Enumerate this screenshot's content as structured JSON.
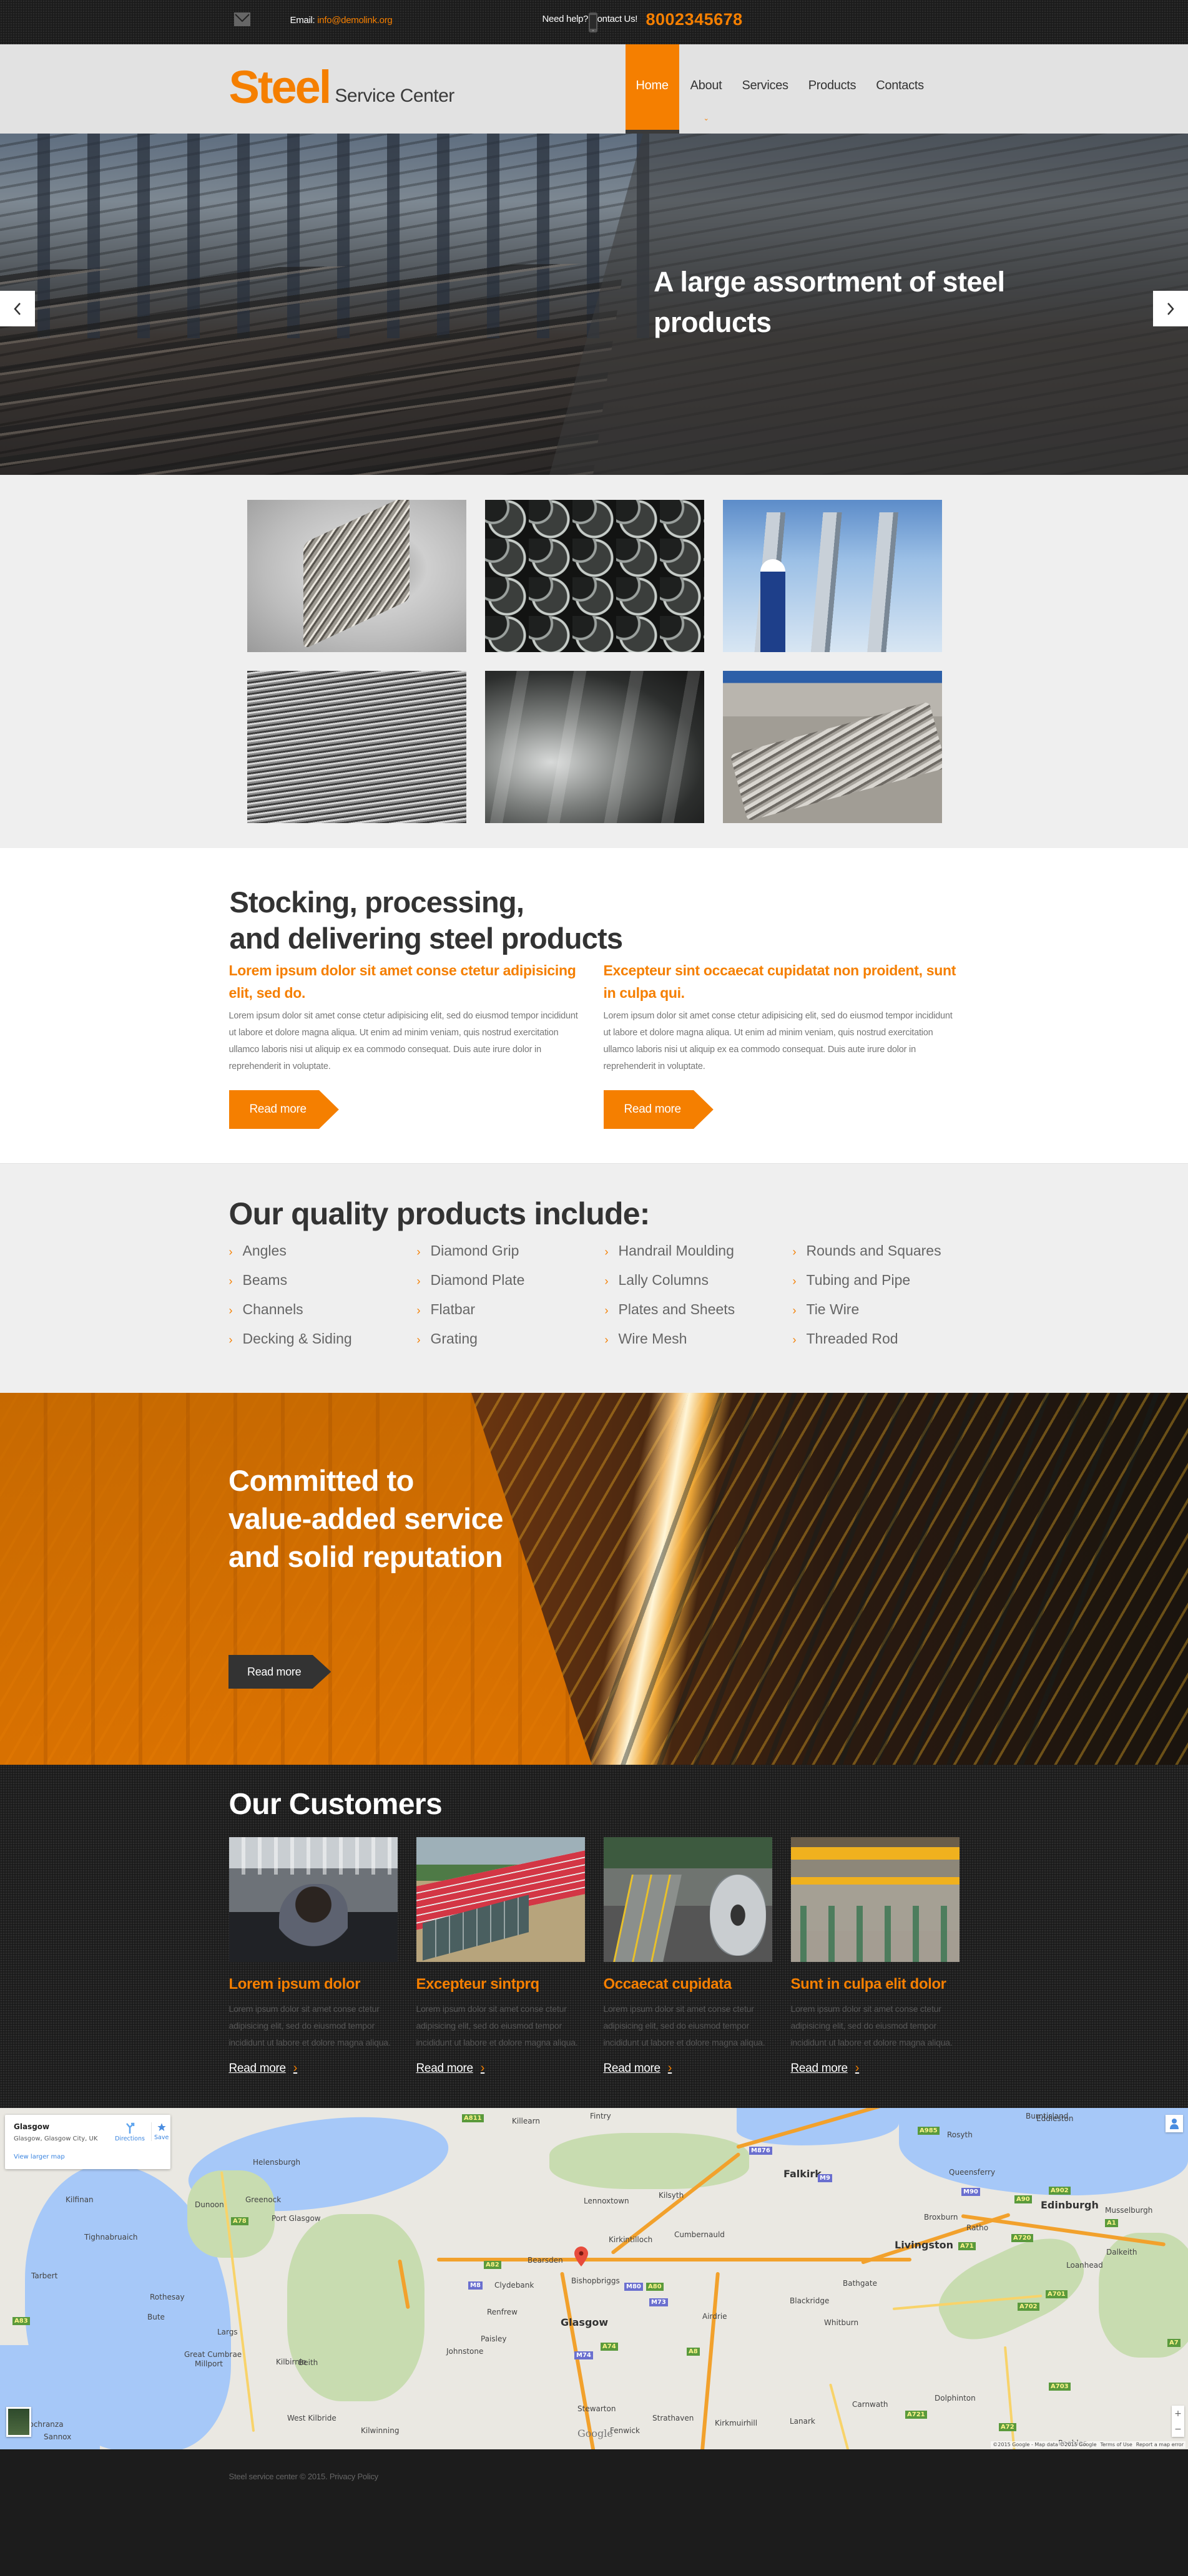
{
  "topbar": {
    "email_label": "Email:",
    "email_value": "info@demolink.org",
    "help_text": "Need help? Contact Us!",
    "phone": "8002345678"
  },
  "header": {
    "logo_main": "Steel",
    "logo_sub": "Service Center",
    "nav": [
      {
        "label": "Home",
        "active": true
      },
      {
        "label": "About",
        "has_dropdown": true
      },
      {
        "label": "Services"
      },
      {
        "label": "Products"
      },
      {
        "label": "Contacts"
      }
    ]
  },
  "hero": {
    "title": "A large assortment of steel products",
    "prev_icon": "chevron-left-icon",
    "next_icon": "chevron-right-icon"
  },
  "gallery": {
    "images": [
      {
        "alt": "Stacked steel tubes"
      },
      {
        "alt": "Steel pipe ends"
      },
      {
        "alt": "Industrial steel columns with worker"
      },
      {
        "alt": "Coiled steel wire"
      },
      {
        "alt": "Polished steel sheets"
      },
      {
        "alt": "Steel pipes on pallets"
      }
    ]
  },
  "intro": {
    "title_line1": "Stocking, processing,",
    "title_line2": "and delivering steel products",
    "columns": [
      {
        "subtitle": "Lorem ipsum dolor sit amet conse ctetur adipisicing elit, sed do.",
        "text": "Lorem ipsum dolor sit amet conse ctetur adipisicing elit, sed do eiusmod tempor incididunt ut labore et dolore magna aliqua. Ut enim ad minim veniam, quis nostrud exercitation ullamco laboris nisi ut aliquip ex ea commodo consequat. Duis aute irure dolor in reprehenderit in voluptate.",
        "button": "Read more"
      },
      {
        "subtitle": "Excepteur sint occaecat cupidatat non proident, sunt in culpa qui.",
        "text": "Lorem ipsum dolor sit amet conse ctetur adipisicing elit, sed do eiusmod tempor incididunt ut labore et dolore magna aliqua. Ut enim ad minim veniam, quis nostrud exercitation ullamco laboris nisi ut aliquip ex ea commodo consequat. Duis aute irure dolor in reprehenderit in voluptate.",
        "button": "Read more"
      }
    ]
  },
  "products": {
    "title": "Our quality products include:",
    "items": [
      "Angles",
      "Diamond Grip",
      "Handrail Moulding",
      "Rounds and Squares",
      "Beams",
      "Diamond Plate",
      "Lally Columns",
      "Tubing and Pipe",
      "Channels",
      "Flatbar",
      "Plates and Sheets",
      "Tie Wire",
      "Decking & Siding",
      "Grating",
      "Wire Mesh",
      "Threaded Rod"
    ]
  },
  "banner": {
    "title": "Committed to value-added service and solid reputation",
    "button": "Read more"
  },
  "customers": {
    "title": "Our Customers",
    "items": [
      {
        "name": "Lorem ipsum dolor",
        "text": "Lorem ipsum dolor sit amet conse ctetur adipisicing elit, sed do eiusmod tempor incididunt ut labore et dolore magna aliqua.",
        "link": "Read more"
      },
      {
        "name": "Excepteur sintprq",
        "text": "Lorem ipsum dolor sit amet conse ctetur adipisicing elit, sed do eiusmod tempor incididunt ut labore et dolore magna aliqua.",
        "link": "Read more"
      },
      {
        "name": "Occaecat cupidata",
        "text": "Lorem ipsum dolor sit amet conse ctetur adipisicing elit, sed do eiusmod tempor incididunt ut labore et dolore magna aliqua.",
        "link": "Read more"
      },
      {
        "name": "Sunt in culpa elit dolor",
        "text": "Lorem ipsum dolor sit amet conse ctetur adipisicing elit, sed do eiusmod tempor incididunt ut labore et dolore magna aliqua.",
        "link": "Read more"
      }
    ]
  },
  "map": {
    "card": {
      "title": "Glasgow",
      "address": "Glasgow, Glasgow City, UK",
      "view_larger": "View larger map",
      "directions": "Directions",
      "save": "Save"
    },
    "labels": [
      "Killearn",
      "Fintry",
      "Falkirk",
      "Kilsyth",
      "Lennoxtown",
      "Kirkintilloch",
      "Cumbernauld",
      "Bearsden",
      "Clydebank",
      "Bishopbriggs",
      "Renfrew",
      "Glasgow",
      "Paisley",
      "Johnstone",
      "Airdrie",
      "Blackridge",
      "Bathgate",
      "Whitburn",
      "Edinburgh",
      "Livingston",
      "Musselburgh",
      "Dalkeith",
      "Queensferry",
      "Rosyth",
      "Burntisland",
      "Broxburn",
      "Ratho",
      "Loanhead",
      "Helensburgh",
      "Greenock",
      "Port Glasgow",
      "Dunoon",
      "Rothesay",
      "Bute",
      "Largs",
      "Great Cumbrae",
      "Millport",
      "Kilbirnie",
      "Beith",
      "West Kilbride",
      "Kilwinning",
      "Stewarton",
      "Fenwick",
      "Strathaven",
      "Kirkmuirhill",
      "Lanark",
      "Carnwath",
      "Dolphinton",
      "Peebles",
      "Eddleston",
      "Lochranza",
      "Sannox",
      "Tarbert",
      "Tighnabruaich",
      "Kilfinan"
    ],
    "shields": [
      "M8",
      "M80",
      "M73",
      "M876",
      "M9",
      "M90",
      "M74",
      "A82",
      "A80",
      "A74",
      "A8",
      "A811",
      "A78",
      "A83",
      "A720",
      "A71",
      "A90",
      "A902",
      "A1",
      "A701",
      "A702",
      "A703",
      "A7",
      "A985",
      "A721",
      "A72"
    ],
    "google_logo": "Google",
    "attribution": "©2015 Google - Map data ©2015 Google",
    "terms": "Terms of Use",
    "report": "Report a map error",
    "zoom_in": "+",
    "zoom_out": "−"
  },
  "footer": {
    "text": "Steel service center © 2015.",
    "privacy": "Privacy Policy"
  }
}
